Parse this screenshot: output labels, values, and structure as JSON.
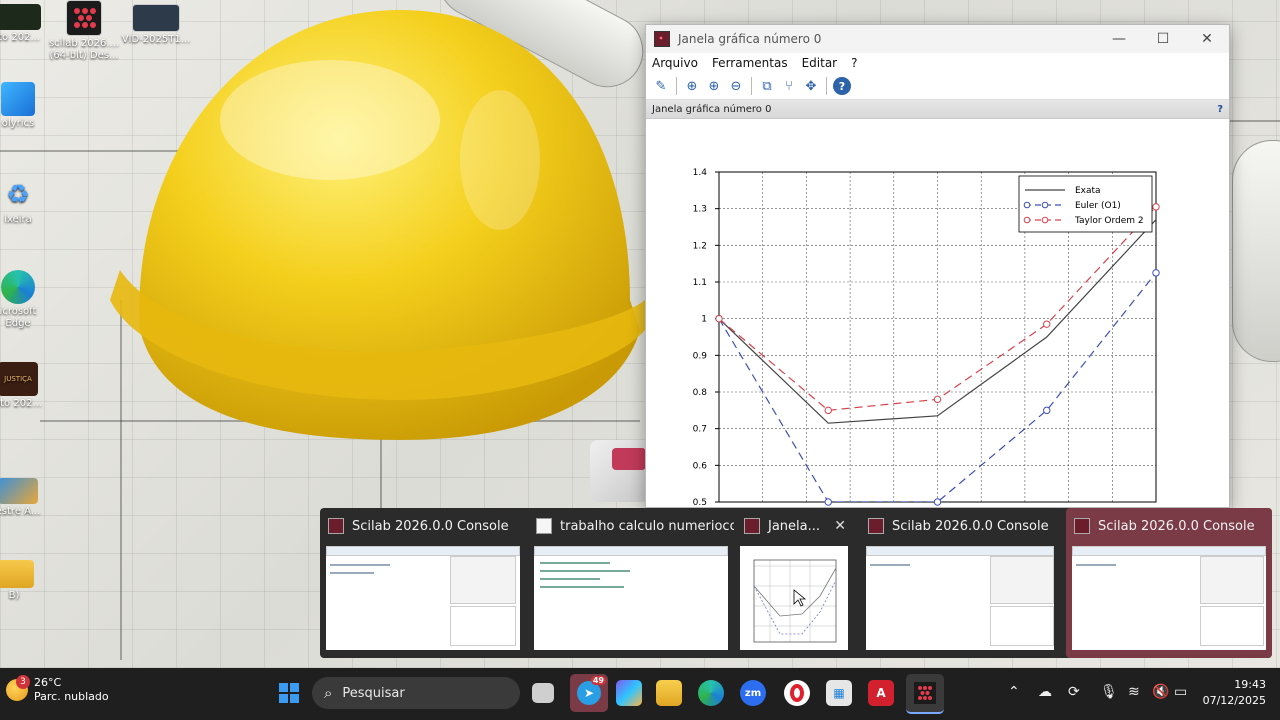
{
  "desktop": {
    "icons": [
      {
        "label": "oto 202...",
        "icon": "video-thumbnail-icon"
      },
      {
        "label": "scilab 2026....\n(64-bit) Des...",
        "icon": "scilab-icon"
      },
      {
        "label": "VID-2025T1...",
        "icon": "video-file-icon"
      },
      {
        "label": "olyrics",
        "icon": "app-icon"
      },
      {
        "label": "ixeira",
        "icon": "recycle-bin-icon"
      },
      {
        "label": "icrosoft\nEdge",
        "icon": "edge-icon"
      },
      {
        "label": "oto 202...",
        "icon": "photo-thumbnail-icon"
      },
      {
        "label": "estre A...",
        "icon": "folder-thumbnail-icon"
      },
      {
        "label": "B)",
        "icon": "folder-icon"
      }
    ],
    "thumbnail_caption": "JUSTIÇA"
  },
  "graphic_window": {
    "title": "Janela gráfica número 0",
    "menu": [
      "Arquivo",
      "Ferramentas",
      "Editar",
      "?"
    ],
    "subtitle": "Janela gráfica número 0",
    "help_mark": "?",
    "buttons": {
      "minimize": "—",
      "maximize": "☐",
      "close": "✕"
    }
  },
  "chart_data": {
    "type": "line",
    "ylim": [
      0.5,
      1.4
    ],
    "xlim": [
      0,
      1
    ],
    "yticks": [
      0.5,
      0.6,
      0.7,
      0.8,
      0.9,
      1,
      1.1,
      1.2,
      1.3,
      1.4
    ],
    "grid": true,
    "legend_position": "top-right",
    "series": [
      {
        "name": "Exata",
        "color": "#444444",
        "dash": "solid",
        "marker": "none",
        "x": [
          0,
          0.25,
          0.5,
          0.75,
          1.0
        ],
        "y": [
          1.0,
          0.715,
          0.735,
          0.95,
          1.27
        ]
      },
      {
        "name": "Euler (O1)",
        "color": "#3d4fb8",
        "dash": "dashed",
        "marker": "circle",
        "x": [
          0,
          0.25,
          0.5,
          0.75,
          1.0
        ],
        "y": [
          1.0,
          0.5,
          0.5,
          0.75,
          1.125
        ]
      },
      {
        "name": "Taylor Ordem 2",
        "color": "#d9434d",
        "dash": "dashed",
        "marker": "circle",
        "x": [
          0,
          0.25,
          0.5,
          0.75,
          1.0
        ],
        "y": [
          1.0,
          0.75,
          0.78,
          0.985,
          1.305
        ]
      }
    ]
  },
  "switcher": {
    "cards": [
      {
        "title": "Scilab 2026.0.0 Console",
        "icon": "scilab-icon",
        "selected": false
      },
      {
        "title": "trabalho calculo numerioco...",
        "icon": "document-icon",
        "selected": false
      },
      {
        "title": "Janela...",
        "icon": "scilab-icon",
        "selected": false,
        "close": "✕"
      },
      {
        "title": "Scilab 2026.0.0 Console",
        "icon": "scilab-icon",
        "selected": false
      },
      {
        "title": "Scilab 2026.0.0 Console",
        "icon": "scilab-icon",
        "selected": true
      }
    ]
  },
  "taskbar": {
    "weather_temp": "26°C",
    "weather_desc": "Parc. nublado",
    "weather_badge": "3",
    "search_placeholder": "Pesquisar",
    "telegram_badge": "49",
    "zoom_label": "zm",
    "autocad_label": "A",
    "time": "19:43",
    "date": "07/12/2025",
    "colors": {
      "windows": "#3b9bf0",
      "telegram": "#2a9ee4",
      "opera": "#e0202c",
      "autocad": "#d3202e"
    }
  }
}
